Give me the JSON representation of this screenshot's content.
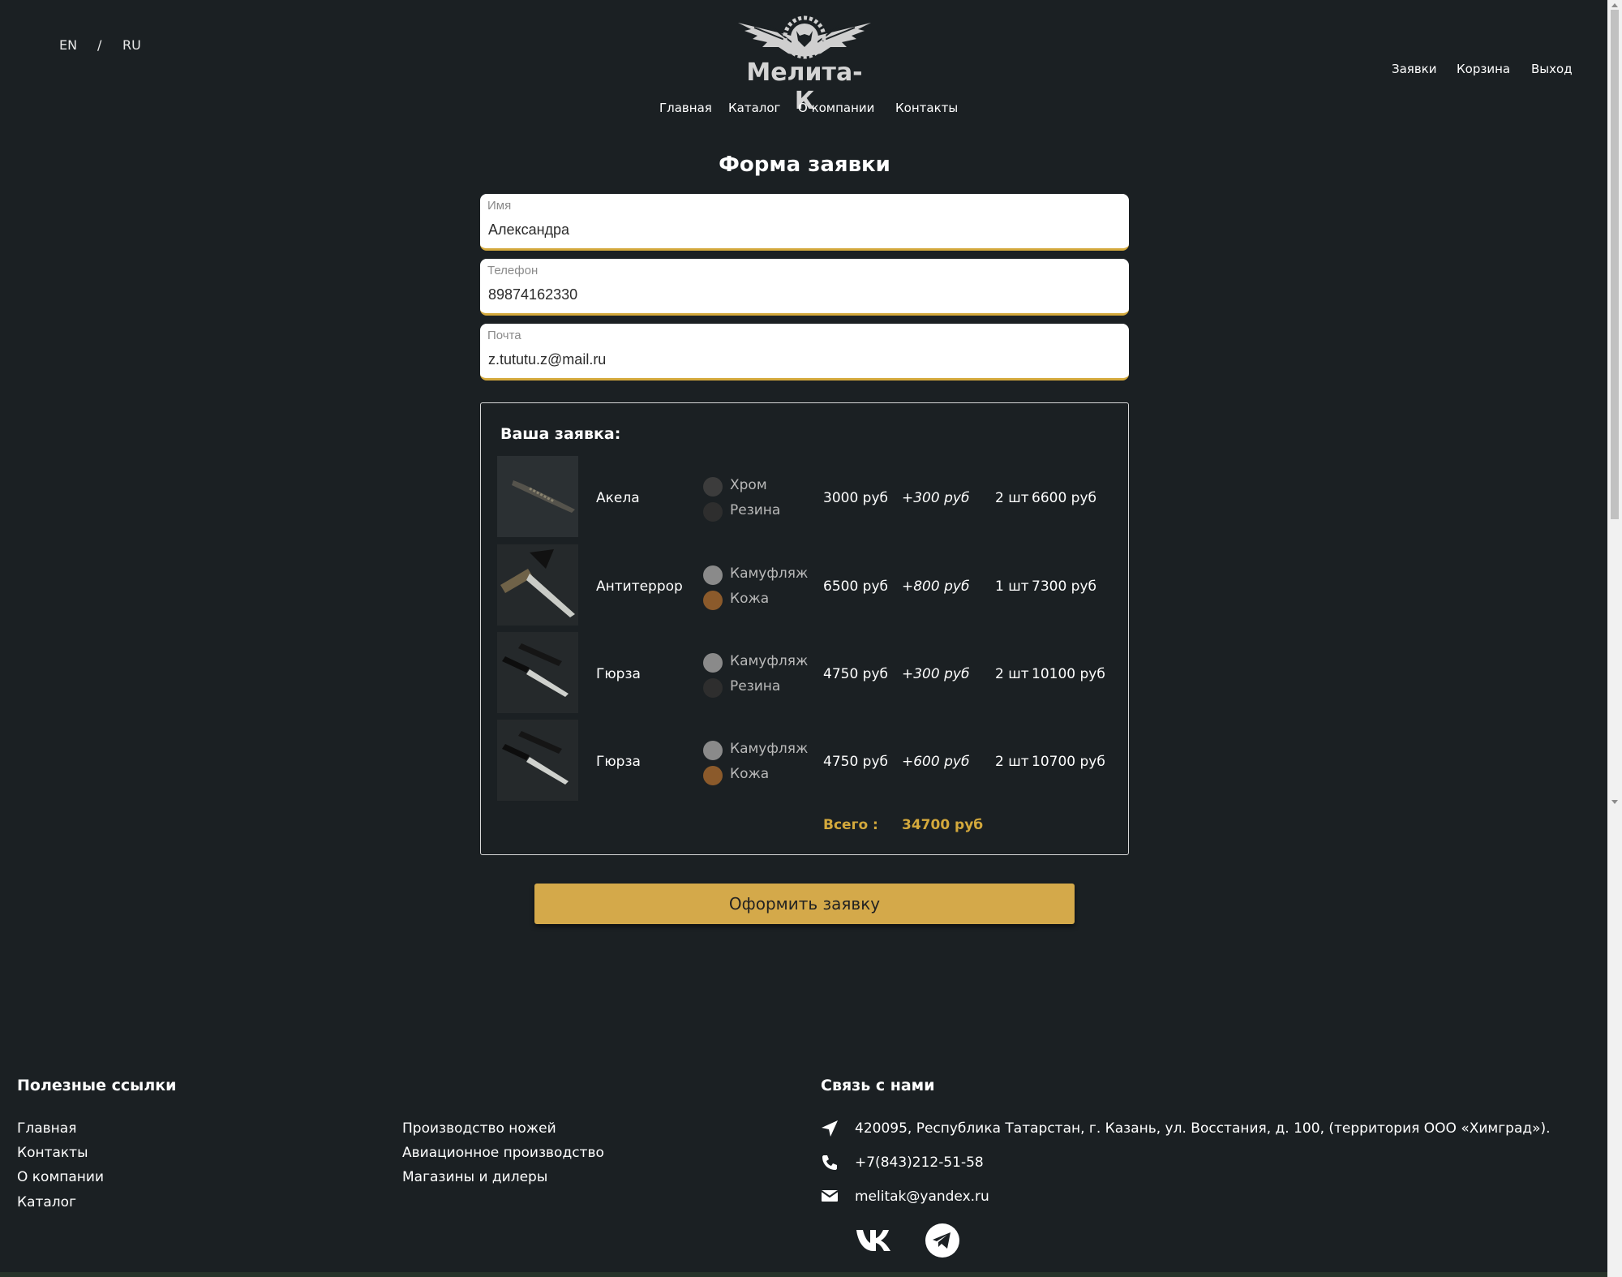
{
  "header": {
    "lang": {
      "en": "EN",
      "separator": "/",
      "ru": "RU"
    },
    "logo_text": "Мелита-К",
    "main_nav": [
      "Главная",
      "Каталог",
      "О компании",
      "Контакты"
    ],
    "user_nav": [
      "Заявки",
      "Корзина",
      "Выход"
    ]
  },
  "form": {
    "title": "Форма заявки",
    "fields": [
      {
        "label": "Имя",
        "value": "Александра"
      },
      {
        "label": "Телефон",
        "value": "89874162330"
      },
      {
        "label": "Почта",
        "value": "z.tututu.z@mail.ru"
      }
    ],
    "order": {
      "title": "Ваша заявка:",
      "items": [
        {
          "name": "Акела",
          "option1": "Хром",
          "option2": "Резина",
          "price": "3000 руб",
          "extra": "+300 руб",
          "qty": "2 шт",
          "sum": "6600 руб",
          "swatch1": "#3c3c3c",
          "swatch2": "#2e2e2e"
        },
        {
          "name": "Антитеррор",
          "option1": "Камуфляж",
          "option2": "Кожа",
          "price": "6500 руб",
          "extra": "+800 руб",
          "qty": "1 шт",
          "sum": "7300 руб",
          "swatch1": "#8a8a8a",
          "swatch2": "#8b5a2b"
        },
        {
          "name": "Гюрза",
          "option1": "Камуфляж",
          "option2": "Резина",
          "price": "4750 руб",
          "extra": "+300 руб",
          "qty": "2 шт",
          "sum": "10100 руб",
          "swatch1": "#8a8a8a",
          "swatch2": "#2e2e2e"
        },
        {
          "name": "Гюрза",
          "option1": "Камуфляж",
          "option2": "Кожа",
          "price": "4750 руб",
          "extra": "+600 руб",
          "qty": "2 шт",
          "sum": "10700 руб",
          "swatch1": "#8a8a8a",
          "swatch2": "#8b5a2b"
        }
      ],
      "total_label": "Всего :",
      "total_value": "34700 руб"
    },
    "submit_label": "Оформить заявку"
  },
  "footer": {
    "links_title": "Полезные ссылки",
    "links_col1": [
      "Главная",
      "Контакты",
      "О компании",
      "Каталог"
    ],
    "links_col2": [
      "Производство ножей",
      "Авиационное производство",
      "Магазины и дилеры"
    ],
    "contact_title": "Связь с нами",
    "address": "420095, Республика Татарстан, г. Казань, ул. Восстания, д. 100, (территория ООО «Химград»).",
    "phone": "+7(843)212-51-58",
    "email": "melitak@yandex.ru",
    "icons": [
      "location-arrow-icon",
      "phone-icon",
      "envelope-icon",
      "vk-icon",
      "telegram-icon"
    ]
  },
  "colors": {
    "background": "#1b2023",
    "accent": "#d4a93c",
    "button": "#d4a94a"
  }
}
